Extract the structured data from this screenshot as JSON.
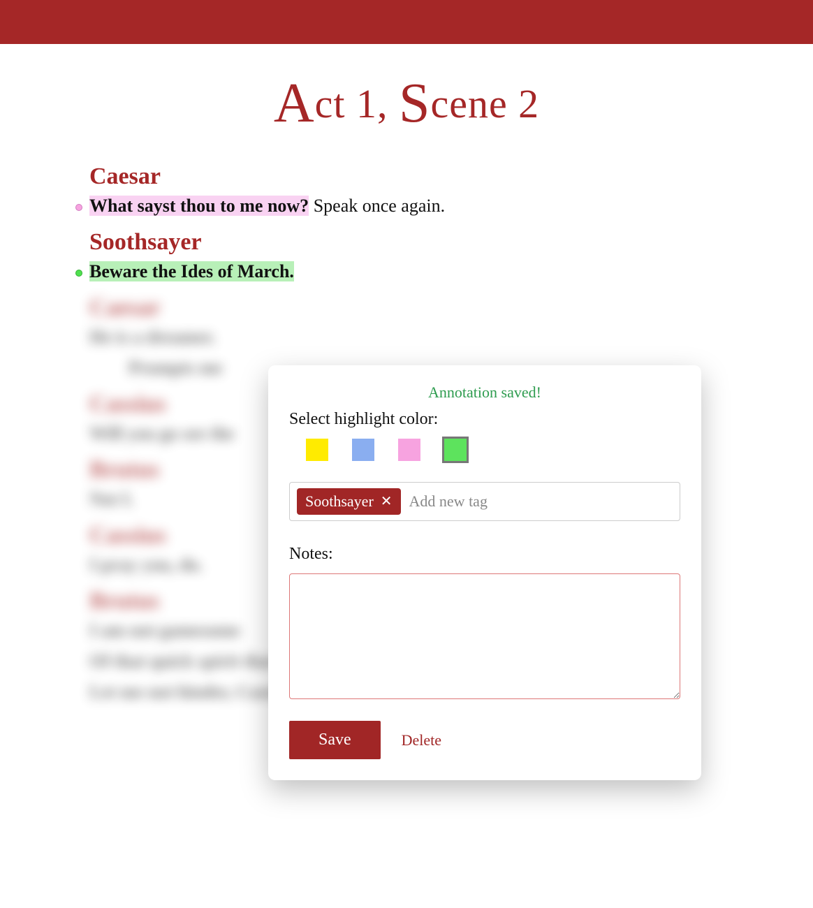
{
  "header": {},
  "scene": {
    "title_part1": "A",
    "title_part2": "ct 1, ",
    "title_part3": "S",
    "title_part4": "cene 2"
  },
  "lines": [
    {
      "speaker": "Caesar",
      "dot_color": "pink",
      "highlighted": "What sayst thou to me now?",
      "rest": " Speak once again.",
      "hl_class": "hl-pink"
    },
    {
      "speaker": "Soothsayer",
      "dot_color": "green",
      "highlighted": "Beware the Ides of March.",
      "rest": "",
      "hl_class": "hl-green"
    }
  ],
  "blurred_lines": [
    {
      "speaker": "Caesar",
      "text": "He is a dreamer."
    },
    {
      "indent": true,
      "text": "Prompts me"
    },
    {
      "speaker": "Cassius",
      "text": "Will you go see the"
    },
    {
      "speaker": "Brutus",
      "text": "Not I."
    },
    {
      "speaker": "Cassius",
      "text": "I pray you, do."
    },
    {
      "speaker": "Brutus",
      "text": "I am not gamesome"
    },
    {
      "text": "Of that quick spirit that is in Antony"
    },
    {
      "text": "Let me not hinder, Cassius, your desires"
    }
  ],
  "popup": {
    "saved_message": "Annotation saved!",
    "select_color_label": "Select highlight color:",
    "colors": {
      "yellow": "#ffeb00",
      "blue": "#8aaef0",
      "pink": "#f7a3e0",
      "green": "#5de35d"
    },
    "selected_color": "green",
    "tags": [
      {
        "label": "Soothsayer"
      }
    ],
    "tag_placeholder": "Add new tag",
    "notes_label": "Notes:",
    "notes_value": "",
    "save_label": "Save",
    "delete_label": "Delete"
  }
}
